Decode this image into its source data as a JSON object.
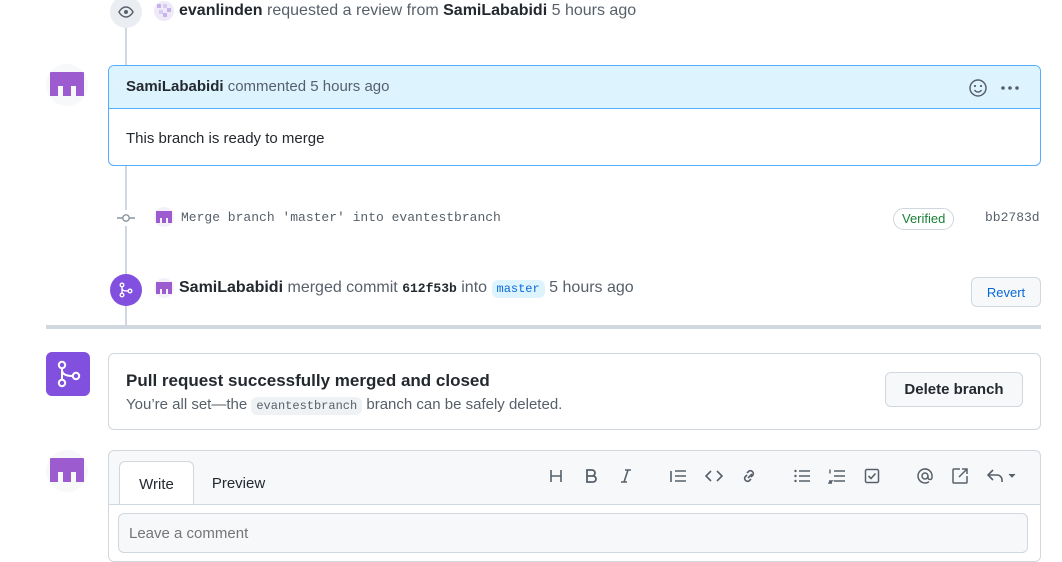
{
  "events": {
    "review_request": {
      "actor": "evanlinden",
      "action": "requested a review from",
      "target": "SamiLababidi",
      "time": "5 hours ago"
    },
    "comment": {
      "author": "SamiLababidi",
      "action": "commented",
      "time": "5 hours ago",
      "body": "This branch is ready to merge"
    },
    "commit": {
      "message": "Merge branch 'master' into evantestbranch",
      "badge": "Verified",
      "sha": "bb2783d"
    },
    "merge": {
      "actor": "SamiLababidi",
      "action": "merged commit",
      "commit": "612f53b",
      "into": "into",
      "branch": "master",
      "time": "5 hours ago",
      "revert_label": "Revert"
    }
  },
  "merged_box": {
    "title": "Pull request successfully merged and closed",
    "text_prefix": "You’re all set—the",
    "branch": "evantestbranch",
    "text_suffix": "branch can be safely deleted.",
    "delete_label": "Delete branch"
  },
  "comment_form": {
    "tabs": [
      "Write",
      "Preview"
    ],
    "placeholder": "Leave a comment",
    "toolbar_icons": [
      "heading-icon",
      "bold-icon",
      "italic-icon",
      "quote-icon",
      "code-icon",
      "link-icon",
      "bulleted-list-icon",
      "numbered-list-icon",
      "task-list-icon",
      "mention-icon",
      "reference-icon",
      "saved-replies-icon"
    ]
  },
  "colors": {
    "merged_purple": "#8250df",
    "link_blue": "#0969da",
    "verified_green": "#1a7f37",
    "comment_header_bg": "#ddf4ff",
    "comment_border": "#54aeff"
  }
}
